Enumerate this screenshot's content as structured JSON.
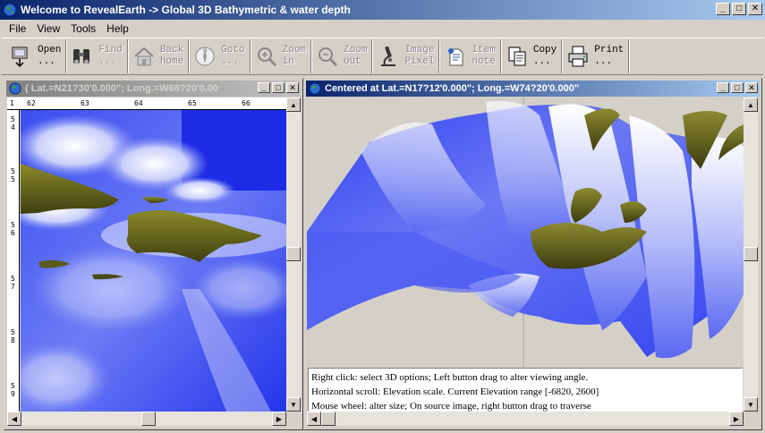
{
  "window": {
    "title": "Welcome to RevealEarth -> Global 3D Bathymetric &  water depth"
  },
  "menu": [
    "File",
    "View",
    "Tools",
    "Help"
  ],
  "toolbar": [
    {
      "icon": "open-icon",
      "label": "Open\n...",
      "enabled": true
    },
    {
      "icon": "binoculars-icon",
      "label": "Find\n...",
      "enabled": false
    },
    {
      "icon": "home-icon",
      "label": "Back\nhome",
      "enabled": false
    },
    {
      "icon": "compass-icon",
      "label": "Goto\n...",
      "enabled": false
    },
    {
      "icon": "zoom-in-icon",
      "label": "Zoom\nin",
      "enabled": false
    },
    {
      "icon": "zoom-out-icon",
      "label": "Zoom\nout",
      "enabled": false
    },
    {
      "icon": "microscope-icon",
      "label": "Image\nPixel",
      "enabled": false
    },
    {
      "icon": "note-icon",
      "label": "Item\nnote",
      "enabled": false
    },
    {
      "icon": "copy-icon",
      "label": "Copy\n...",
      "enabled": true
    },
    {
      "icon": "printer-icon",
      "label": "Print\n...",
      "enabled": true
    }
  ],
  "left_pane": {
    "title": "( Lat.=N21?30'0.000\"; Long.=W68?20'0.00",
    "ruler_top": [
      "1",
      "62",
      "63",
      "64",
      "65",
      "66"
    ],
    "ruler_left": [
      [
        "5",
        "4"
      ],
      [
        "5",
        "5"
      ],
      [
        "5",
        "6"
      ],
      [
        "5",
        "7"
      ],
      [
        "5",
        "8"
      ],
      [
        "5",
        "9"
      ]
    ]
  },
  "right_pane": {
    "title": "Centered at Lat.=N17?12'0.000\"; Long.=W74?20'0.000\"",
    "info": [
      "Right click: select 3D options; Left button drag to alter viewing angle.",
      "Horizontal scroll: Elevation scale. Current Elevation range [-6820, 2600]",
      "Mouse wheel: alter size; On source image, right button drag to traverse"
    ]
  },
  "window_buttons": {
    "minimize": "_",
    "maximize": "□",
    "close": "✕"
  }
}
